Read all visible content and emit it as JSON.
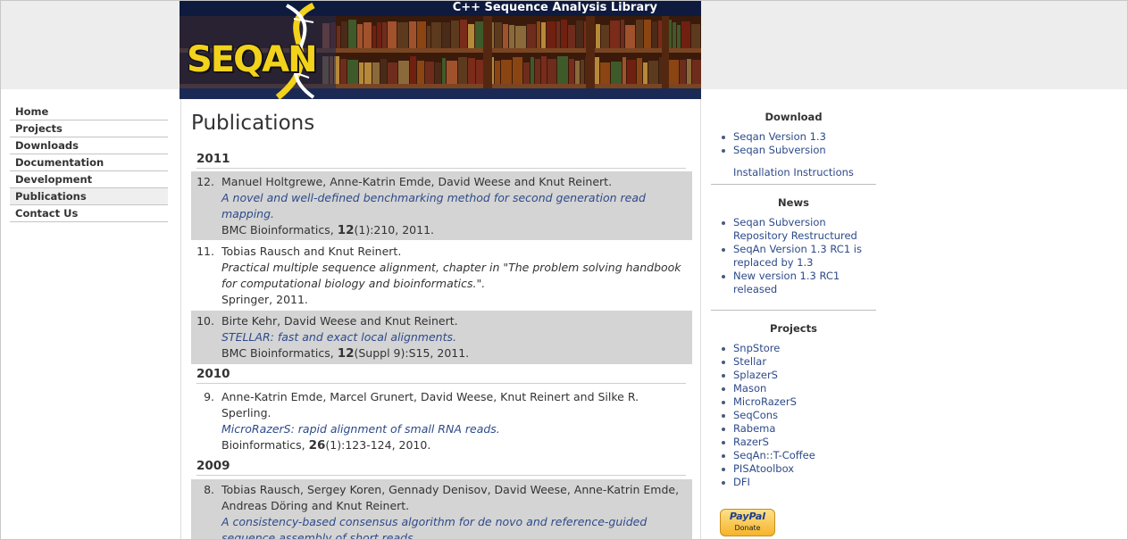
{
  "header": {
    "tagline": "C++ Sequence Analysis Library",
    "logo_text": "SEQAN"
  },
  "nav": {
    "items": [
      {
        "label": "Home"
      },
      {
        "label": "Projects"
      },
      {
        "label": "Downloads"
      },
      {
        "label": "Documentation"
      },
      {
        "label": "Development"
      },
      {
        "label": "Publications"
      },
      {
        "label": "Contact Us"
      }
    ],
    "active": "Publications"
  },
  "main": {
    "title": "Publications",
    "years": [
      "2011",
      "2010",
      "2009"
    ],
    "publications": [
      {
        "num": "12.",
        "authors": "Manuel Holtgrewe, Anne-Katrin Emde, David Weese and Knut Reinert.",
        "title": "A novel and well-defined benchmarking method for second generation read mapping.",
        "journal": "BMC Bioinformatics,",
        "volume": "12",
        "rest": "(1):210, 2011."
      },
      {
        "num": "11.",
        "authors": "Tobias Rausch and Knut Reinert.",
        "title": "Practical multiple sequence alignment, chapter in \"The problem solving handbook for computational biology and bioinformatics.\".",
        "publisher": "Springer, 2011."
      },
      {
        "num": "10.",
        "authors": "Birte Kehr, David Weese and Knut Reinert.",
        "title": "STELLAR: fast and exact local alignments.",
        "journal": "BMC Bioinformatics,",
        "volume": "12",
        "rest": "(Suppl 9):S15, 2011."
      },
      {
        "num": "9.",
        "authors": "Anne-Katrin Emde, Marcel Grunert, David Weese, Knut Reinert and Silke R. Sperling.",
        "title": "MicroRazerS: rapid alignment of small RNA reads.",
        "journal": "Bioinformatics,",
        "volume": "26",
        "rest": "(1):123-124, 2010."
      },
      {
        "num": "8.",
        "authors": "Tobias Rausch, Sergey Koren, Gennady Denisov, David Weese, Anne-Katrin Emde, Andreas Döring and Knut Reinert.",
        "title": "A consistency-based consensus algorithm for de novo and reference-guided sequence assembly of short reads."
      }
    ]
  },
  "sidebar": {
    "download": {
      "heading": "Download",
      "items": [
        "Seqan Version 1.3",
        "Seqan Subversion"
      ],
      "install_link": "Installation Instructions"
    },
    "news": {
      "heading": "News",
      "items": [
        "Seqan Subversion Repository Restructured",
        "SeqAn Version 1.3 RC1 is replaced by 1.3",
        "New version 1.3 RC1 released"
      ]
    },
    "projects": {
      "heading": "Projects",
      "items": [
        "SnpStore",
        "Stellar",
        "SplazerS",
        "Mason",
        "MicroRazerS",
        "SeqCons",
        "Rabema",
        "RazerS",
        "SeqAn::T-Coffee",
        "PISAtoolbox",
        "DFI"
      ]
    },
    "paypal": {
      "brand": "PayPal",
      "label": "Donate"
    }
  },
  "colors": {
    "link": "#2d4a8a",
    "header_bg": "#1b2a55",
    "logo": "#f2d21b",
    "shade": "#d4d4d4"
  }
}
